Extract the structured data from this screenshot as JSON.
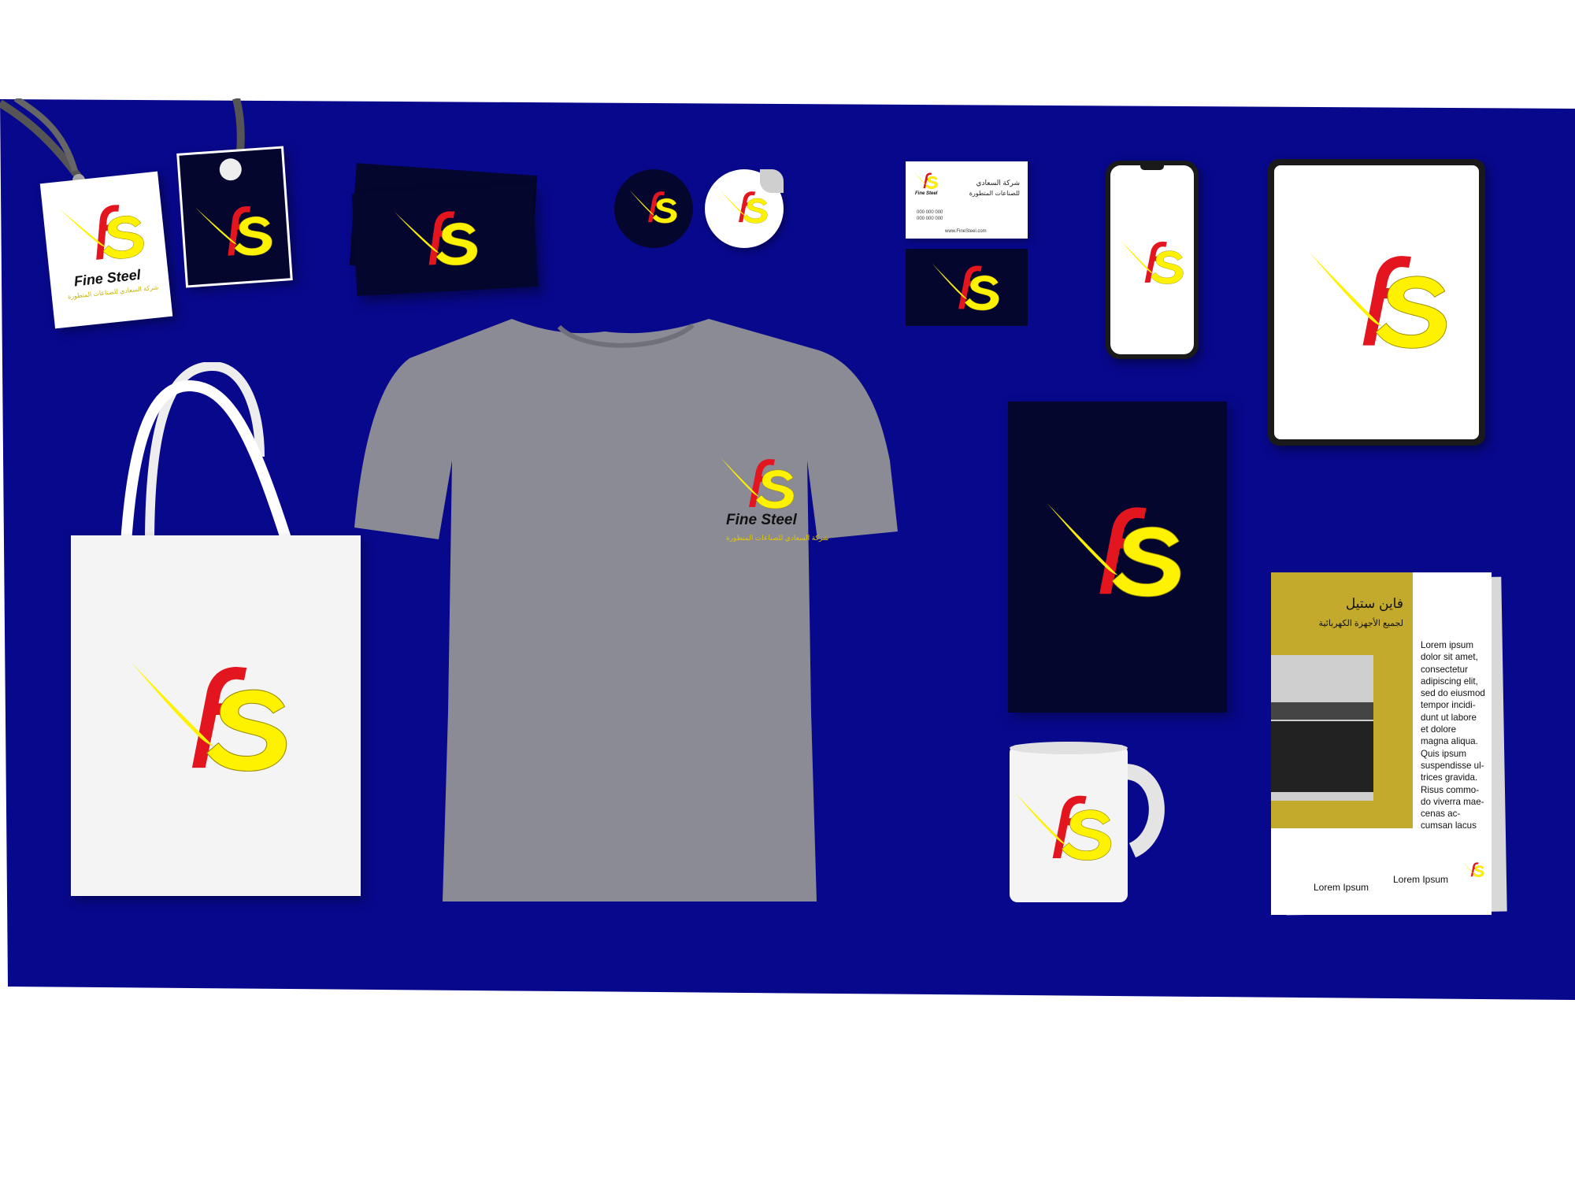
{
  "brand": {
    "monogram_f": "f",
    "monogram_s": "s",
    "name": "Fine Steel",
    "arabic_tagline": "شركة السعادي للصناعات المتطورة"
  },
  "business_card": {
    "arabic_line1": "شركة السعادي",
    "arabic_line2": "للصناعات المتطورة",
    "phone1": "000 000 000",
    "phone2": "000 000 000",
    "website": "www.FineSteel.com"
  },
  "flyer": {
    "arabic_title": "فاين ستيل",
    "arabic_subtitle": "لجميع الأجهزة الكهربائية",
    "body_lines": [
      "Lorem ipsum",
      "dolor sit amet,",
      "consectetur",
      "adipiscing elit,",
      "sed do eiusmod",
      "tempor incidi-",
      "dunt ut labore",
      "et dolore",
      "magna aliqua.",
      "Quis ipsum",
      "suspendisse ul-",
      "trices gravida.",
      "Risus commo-",
      "do viverra mae-",
      "cenas ac-",
      "cumsan lacus"
    ],
    "footer_left": "Lorem Ipsum",
    "footer_right": "Lorem Ipsum"
  },
  "colors": {
    "backdrop": "#08088c",
    "navy": "#04062e",
    "red": "#e3151e",
    "yellow": "#fff200",
    "gold": "#c4aa2c",
    "shirt": "#8a8b94"
  },
  "icons": [
    "fs-logo-icon",
    "lanyard-icon",
    "oven-icon"
  ]
}
